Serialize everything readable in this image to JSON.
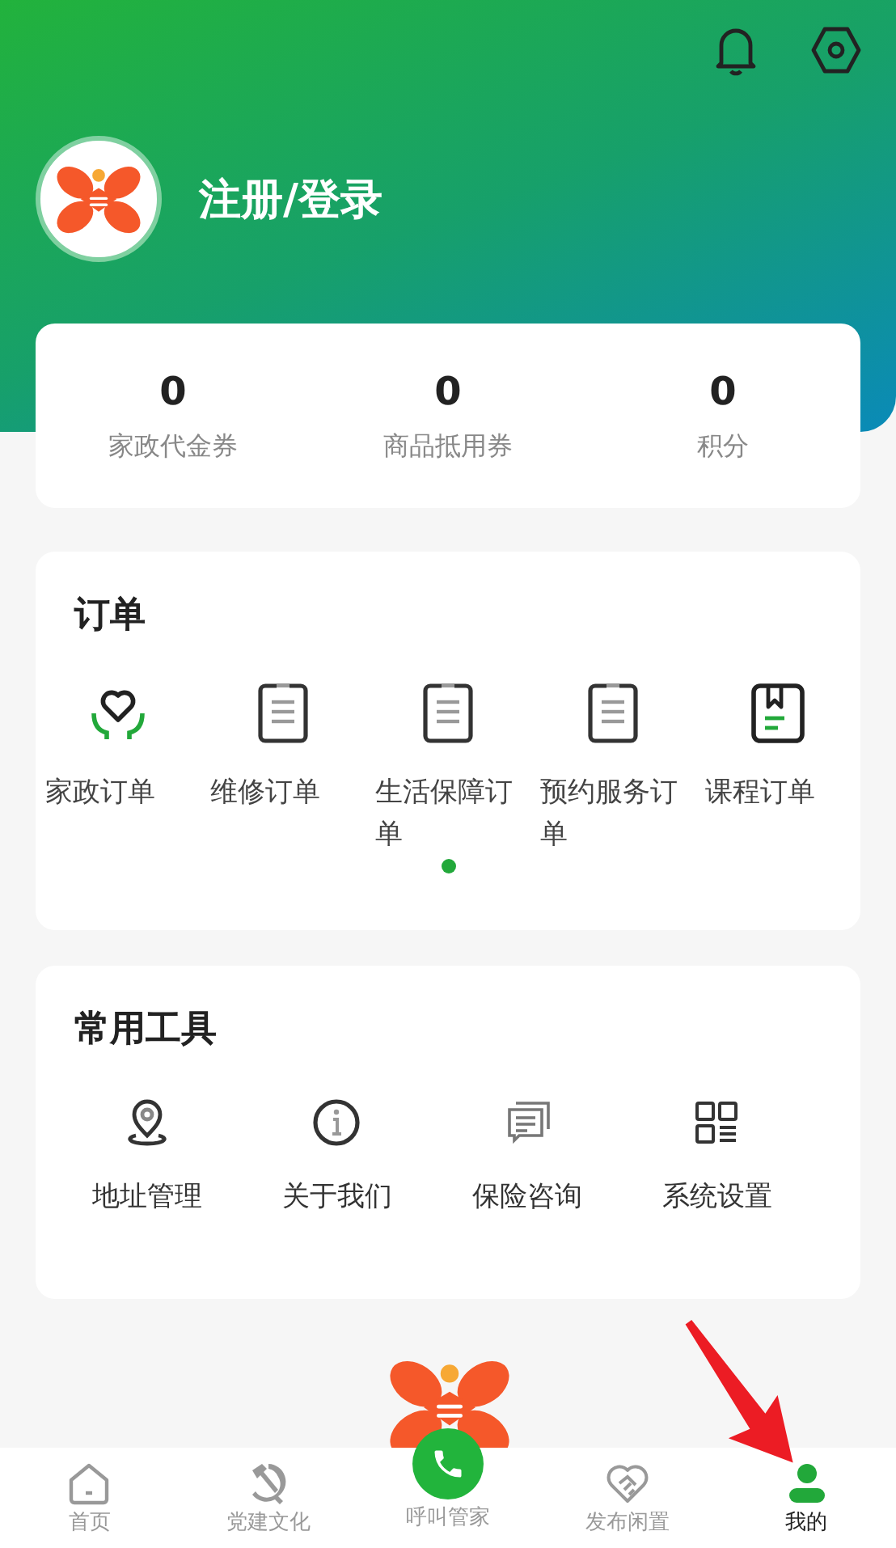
{
  "header": {
    "login_label": "注册/登录"
  },
  "stats": [
    {
      "value": "0",
      "label": "家政代金券"
    },
    {
      "value": "0",
      "label": "商品抵用券"
    },
    {
      "value": "0",
      "label": "积分"
    }
  ],
  "orders": {
    "title": "订单",
    "items": [
      {
        "label": "家政订单"
      },
      {
        "label": "维修订单"
      },
      {
        "label": "生活保障订单"
      },
      {
        "label": "预约服务订单"
      },
      {
        "label": "课程订单"
      }
    ]
  },
  "tools": {
    "title": "常用工具",
    "items": [
      {
        "label": "地址管理"
      },
      {
        "label": "关于我们"
      },
      {
        "label": "保险咨询"
      },
      {
        "label": "系统设置"
      }
    ]
  },
  "bottom_nav": [
    {
      "kind": "tab",
      "label": "首页",
      "selected": false
    },
    {
      "kind": "tab",
      "label": "党建文化",
      "selected": false
    },
    {
      "kind": "call",
      "label": "呼叫管家",
      "selected": false
    },
    {
      "kind": "tab",
      "label": "发布闲置",
      "selected": false
    },
    {
      "kind": "tab",
      "label": "我的",
      "selected": true
    }
  ]
}
